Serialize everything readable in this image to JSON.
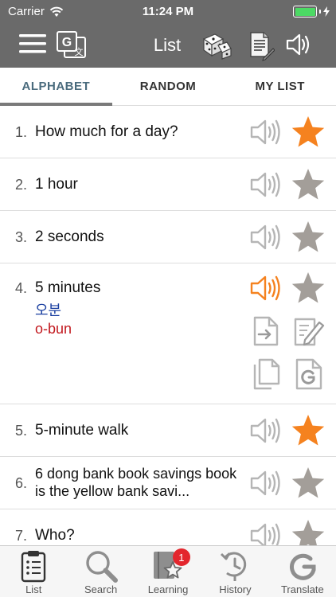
{
  "status_bar": {
    "carrier": "Carrier",
    "time": "11:24 PM",
    "battery_level": 1.0
  },
  "nav": {
    "title": "List"
  },
  "tabs": [
    {
      "label": "ALPHABET",
      "active": true
    },
    {
      "label": "RANDOM",
      "active": false
    },
    {
      "label": "MY LIST",
      "active": false
    }
  ],
  "items": [
    {
      "num": "1.",
      "phrase": "How much for a day?",
      "favorite": true,
      "playing": false
    },
    {
      "num": "2.",
      "phrase": "1 hour",
      "favorite": false,
      "playing": false
    },
    {
      "num": "3.",
      "phrase": "2 seconds",
      "favorite": false,
      "playing": false
    },
    {
      "num": "4.",
      "phrase": "5 minutes",
      "korean": "오분",
      "romanization": "o-bun",
      "favorite": false,
      "playing": true,
      "expanded": true
    },
    {
      "num": "5.",
      "phrase": "5-minute walk",
      "favorite": true,
      "playing": false
    },
    {
      "num": "6.",
      "phrase": "6 dong bank book savings book is the yellow bank savi...",
      "favorite": false,
      "playing": false
    },
    {
      "num": "7.",
      "phrase": "Who?",
      "favorite": false,
      "playing": false
    }
  ],
  "bottom_bar": {
    "list": "List",
    "search": "Search",
    "learning": "Learning",
    "learning_badge": "1",
    "history": "History",
    "translate": "Translate"
  },
  "colors": {
    "bar_gray": "#6a6a6a",
    "star_favorite": "#f5821f",
    "star_default": "#a39e99",
    "speaker_active": "#f5821f",
    "speaker_default": "#b5b5b5",
    "korean_text": "#1a3fa0",
    "roman_text": "#c2181e",
    "badge": "#e3262d"
  }
}
